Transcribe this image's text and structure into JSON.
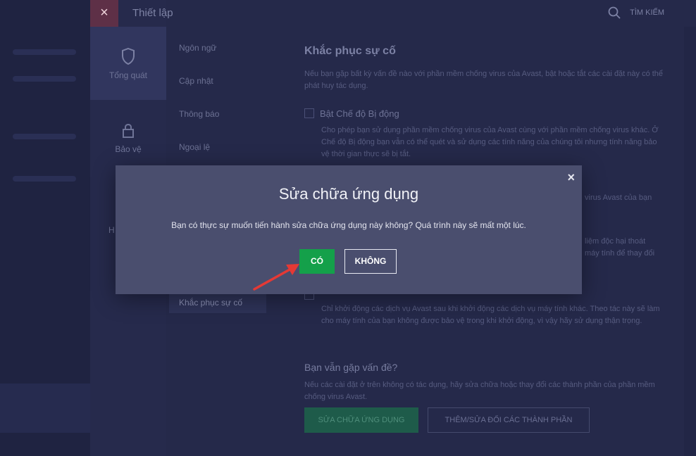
{
  "header": {
    "close_glyph": "×",
    "title": "Thiết lập",
    "search_label": "TÌM KIẾM",
    "search_icon": "search-icon"
  },
  "categories": [
    {
      "label": "Tổng quát",
      "icon": "shield-icon",
      "active": true
    },
    {
      "label": "Bảo vệ",
      "icon": "lock-icon",
      "active": false
    },
    {
      "label": "H",
      "icon": "",
      "active": false
    }
  ],
  "submenu": [
    {
      "label": "Ngôn ngữ"
    },
    {
      "label": "Cập nhật"
    },
    {
      "label": "Thông báo"
    },
    {
      "label": "Ngoại lệ"
    },
    {
      "label": "Khắc phục sự cố",
      "active": true
    }
  ],
  "content": {
    "title": "Khắc phục sự cố",
    "intro": "Nếu bạn gặp bất kỳ vấn đề nào với phần mềm chống virus của Avast, bật hoặc tắt các cài đặt này có thể phát huy tác dụng.",
    "option1_label": "Bật Chế độ Bị động",
    "option1_desc": "Cho phép bạn sử dụng phần mềm chống virus của Avast cùng với phần mềm chống virus khác. Ở Chế độ Bị động bạn vẫn có thể quét và sử dụng các tính năng của chúng tôi nhưng tính năng bảo vệ thời gian thực sẽ bị tắt.",
    "partial_right_1": "virus Avast của bạn",
    "partial_right_2": "liệm độc hại thoát",
    "partial_right_3": "máy tính để thay đổi",
    "option3_desc": "Chỉ khởi động các dịch vụ Avast sau khi khởi động các dịch vụ máy tính khác. Theo tác này sẽ làm cho máy tính của bạn không được bảo vệ trong khi khởi động, vì vậy hãy sử dụng thận trọng.",
    "section2_title": "Bạn vẫn gặp vấn đề?",
    "section2_desc": "Nếu các cài đặt ở trên không có tác dụng, hãy sửa chữa hoặc thay đổi các thành phần của phần mềm chống virus Avast.",
    "repair_button": "SỬA CHỮA ỨNG DỤNG",
    "modify_button": "THÊM/SỬA ĐỔI CÁC THÀNH PHẦN"
  },
  "modal": {
    "title": "Sửa chữa ứng dụng",
    "message": "Bạn có thực sự muốn tiến hành sửa chữa ứng dụng này không? Quá trình này sẽ mất một lúc.",
    "yes_label": "CÓ",
    "no_label": "KHÔNG",
    "close_glyph": "×"
  },
  "colors": {
    "accent_green": "#14a04a",
    "modal_bg": "#4a4e6e",
    "arrow_red": "#e53935"
  }
}
